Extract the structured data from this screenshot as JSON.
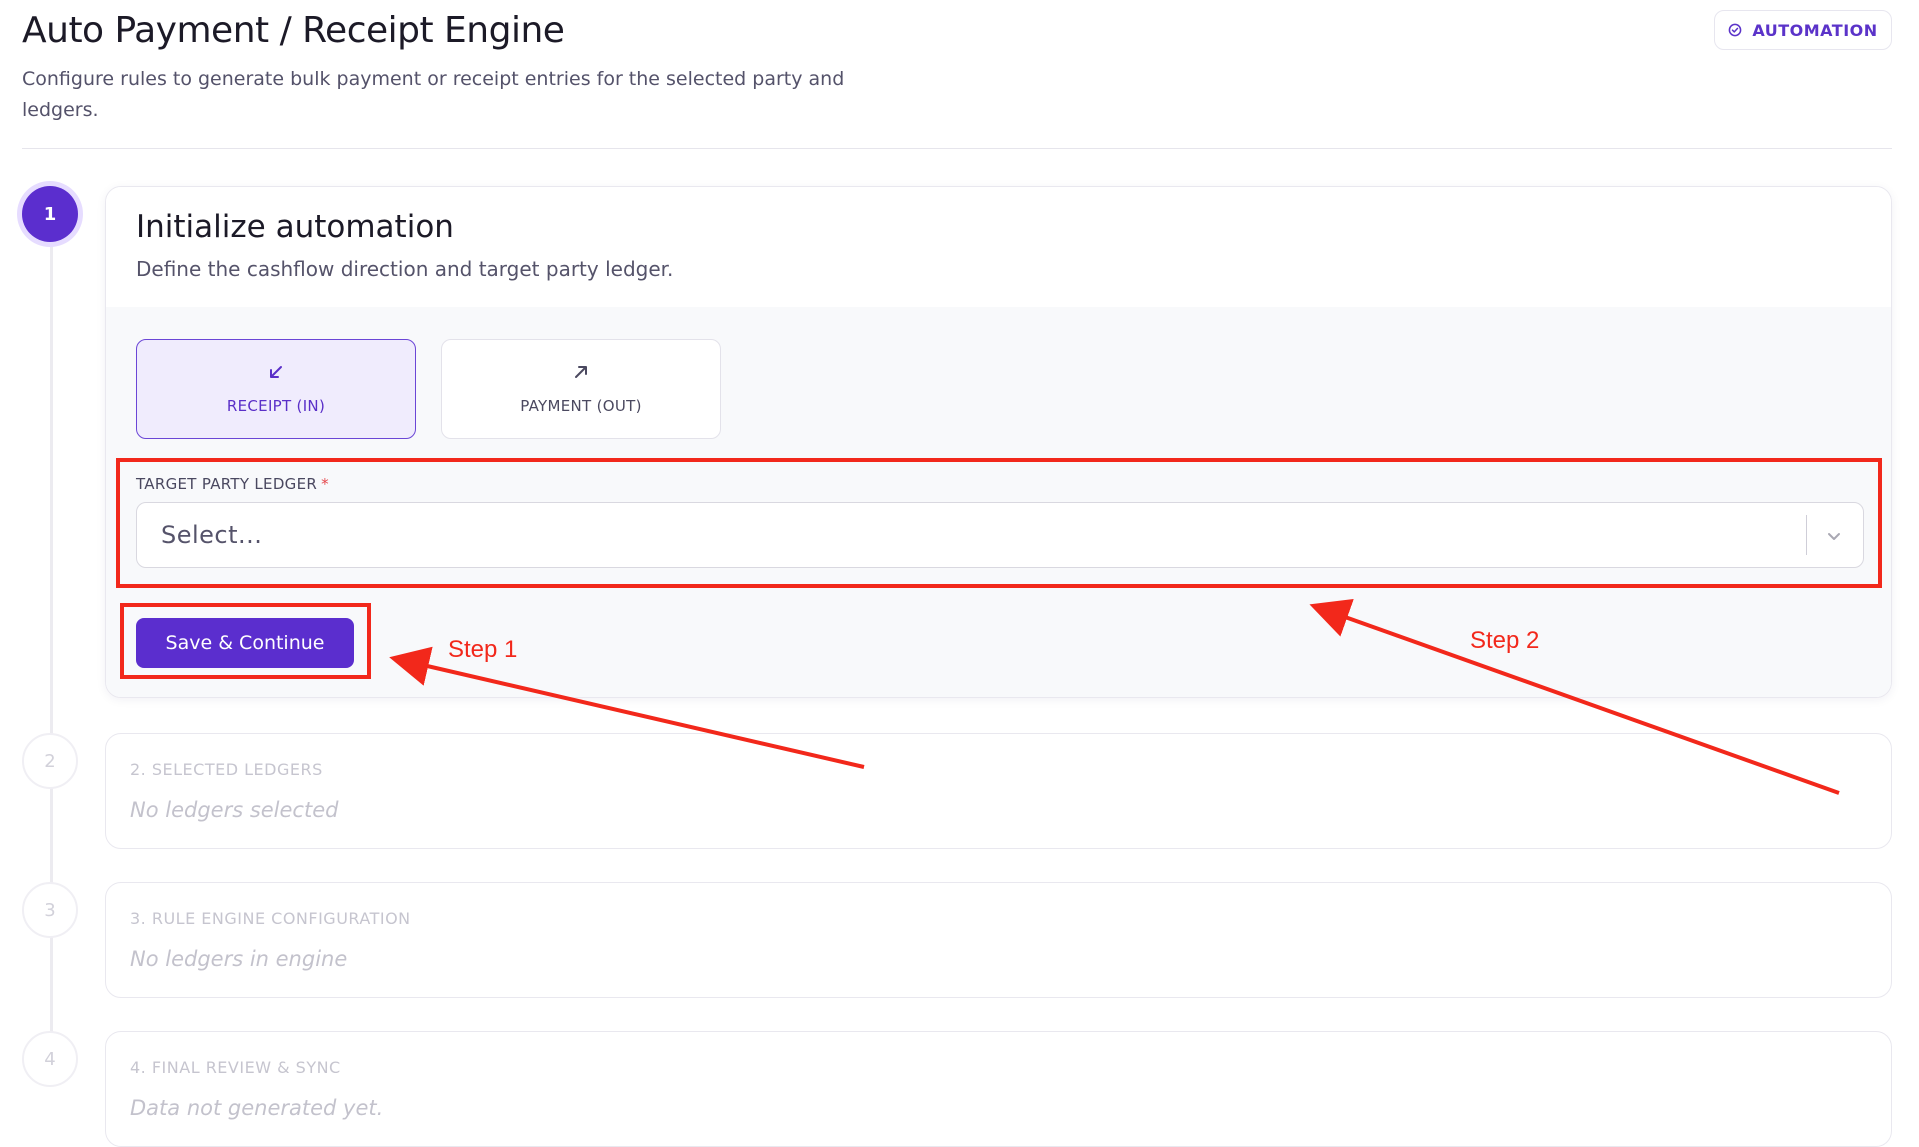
{
  "header": {
    "title": "Auto Payment / Receipt Engine",
    "subtitle": "Configure rules to generate bulk payment or receipt entries for the selected party and ledgers.",
    "badge": {
      "icon": "check-circle-icon",
      "label": "AUTOMATION"
    }
  },
  "steps": [
    {
      "number": "1",
      "state": "active"
    },
    {
      "number": "2",
      "state": "inactive"
    },
    {
      "number": "3",
      "state": "inactive"
    },
    {
      "number": "4",
      "state": "inactive"
    }
  ],
  "step1": {
    "title": "Initialize automation",
    "subtitle": "Define the cashflow direction and target party ledger.",
    "flow_options": [
      {
        "label": "RECEIPT (IN)",
        "icon": "arrow-down-left-icon",
        "selected": true
      },
      {
        "label": "PAYMENT (OUT)",
        "icon": "arrow-up-right-icon",
        "selected": false
      }
    ],
    "ledger_field": {
      "label": "TARGET PARTY LEDGER",
      "required_mark": "*",
      "placeholder": "Select..."
    },
    "save_button": "Save & Continue"
  },
  "step2": {
    "title": "2. SELECTED LEDGERS",
    "note": "No ledgers selected"
  },
  "step3": {
    "title": "3. RULE ENGINE CONFIGURATION",
    "note": "No ledgers in engine"
  },
  "step4": {
    "title": "4. FINAL REVIEW & SYNC",
    "note": "Data not generated yet."
  },
  "annotations": {
    "step1_label": "Step 1",
    "step2_label": "Step 2",
    "color": "#f2281b"
  },
  "colors": {
    "accent": "#5b2ece",
    "accent_soft": "#f0ecfd",
    "muted_text": "#c6c5cf"
  }
}
